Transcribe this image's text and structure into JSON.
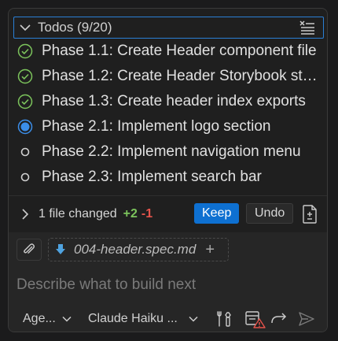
{
  "todos": {
    "title": "Todos (9/20)",
    "items": [
      {
        "label": "Phase 1.1: Create Header component file",
        "status": "completed"
      },
      {
        "label": "Phase 1.2: Create Header Storybook stories",
        "status": "completed"
      },
      {
        "label": "Phase 1.3: Create header index exports",
        "status": "completed"
      },
      {
        "label": "Phase 2.1: Implement logo section",
        "status": "in-progress"
      },
      {
        "label": "Phase 2.2: Implement navigation menu",
        "status": "not-started"
      },
      {
        "label": "Phase 2.3: Implement search bar",
        "status": "not-started"
      }
    ]
  },
  "changes": {
    "summary": "1 file changed",
    "added": "+2",
    "removed": "-1",
    "keep_label": "Keep",
    "undo_label": "Undo"
  },
  "input": {
    "attached_file": "004-header.spec.md",
    "add_label": "+",
    "placeholder": "Describe what to build next"
  },
  "toolbar": {
    "mode": "Age...",
    "model": "Claude Haiku ..."
  },
  "colors": {
    "accent": "#0e70d1",
    "completed": "#7cc45c",
    "added": "#7cc45c",
    "removed": "#e5534b",
    "focus_border": "#2a7fd6"
  }
}
